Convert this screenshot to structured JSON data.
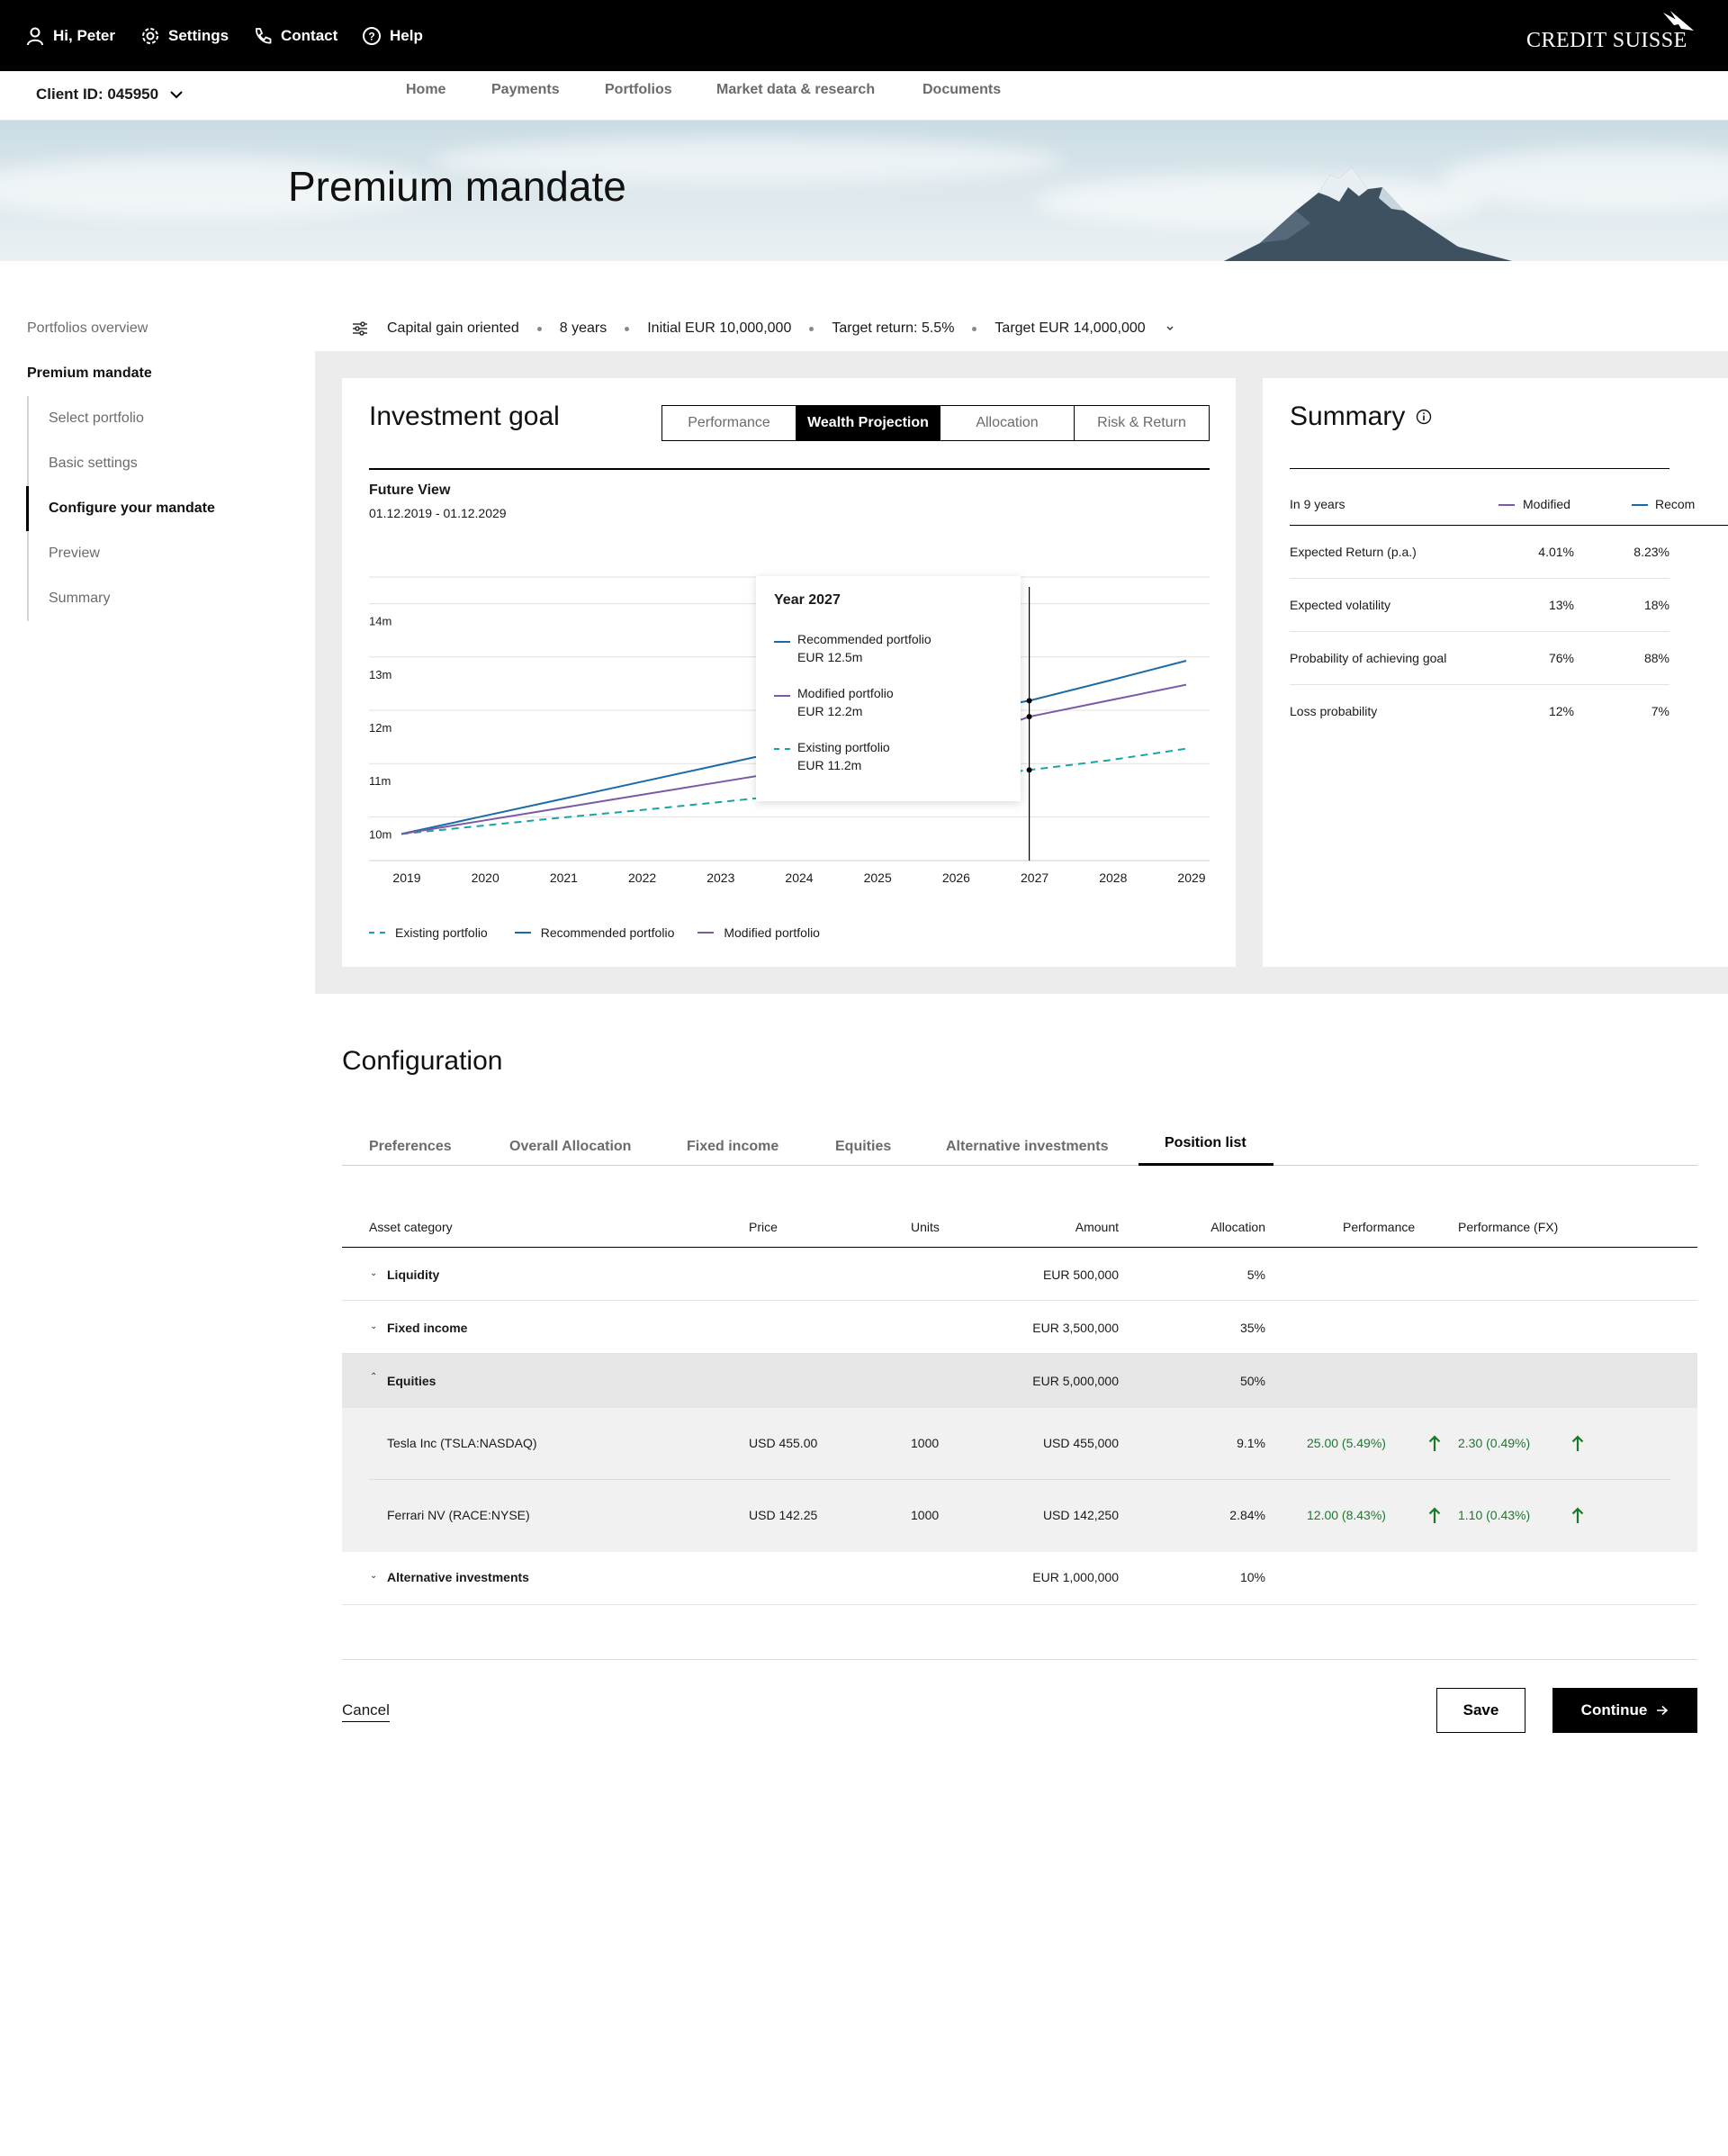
{
  "header": {
    "greeting": "Hi, Peter",
    "settings": "Settings",
    "contact": "Contact",
    "help": "Help",
    "logo": "CREDIT SUISSE"
  },
  "subnav": {
    "client_id": "Client ID: 045950",
    "items": [
      "Home",
      "Payments",
      "Portfolios",
      "Market data & research",
      "Documents"
    ]
  },
  "hero": {
    "title": "Premium mandate"
  },
  "leftnav": {
    "overview": "Portfolios overview",
    "section": "Premium mandate",
    "steps": [
      "Select portfolio",
      "Basic settings",
      "Configure your mandate",
      "Preview",
      "Summary"
    ],
    "active_step": "Configure your mandate"
  },
  "filters": {
    "strategy": "Capital gain oriented",
    "horizon": "8 years",
    "initial": "Initial EUR 10,000,000",
    "target_return": "Target return: 5.5%",
    "target": "Target EUR 14,000,000"
  },
  "investment_goal": {
    "title": "Investment goal",
    "tabs": [
      "Performance",
      "Wealth Projection",
      "Allocation",
      "Risk & Return"
    ],
    "active_tab": "Wealth Projection",
    "subtitle": "Future View",
    "date_range": "01.12.2019 - 01.12.2029"
  },
  "chart_data": {
    "type": "line",
    "x": [
      2019,
      2020,
      2021,
      2022,
      2023,
      2024,
      2025,
      2026,
      2027,
      2028,
      2029
    ],
    "y_ticks": [
      "10m",
      "11m",
      "12m",
      "13m",
      "14m"
    ],
    "ylim": [
      9.5,
      14.5
    ],
    "series": [
      {
        "name": "Existing portfolio",
        "style": "dashed",
        "color": "#19a3a3",
        "values": [
          10.0,
          10.15,
          10.3,
          10.44,
          10.59,
          10.74,
          10.89,
          11.04,
          11.2,
          11.38,
          11.6
        ]
      },
      {
        "name": "Recommended portfolio",
        "style": "solid",
        "color": "#1a6aa8",
        "values": [
          10.0,
          10.32,
          10.64,
          10.96,
          11.28,
          11.6,
          11.92,
          12.24,
          12.5,
          12.87,
          13.25
        ]
      },
      {
        "name": "Modified portfolio",
        "style": "solid",
        "color": "#7a5aa6",
        "values": [
          10.0,
          10.24,
          10.48,
          10.72,
          10.96,
          11.2,
          11.44,
          11.68,
          12.2,
          12.5,
          12.8
        ]
      }
    ],
    "marker_x": 2027,
    "tooltip": {
      "title": "Year 2027",
      "items": [
        {
          "name": "Recommended portfolio",
          "value": "EUR 12.5m"
        },
        {
          "name": "Modified portfolio",
          "value": "EUR 12.2m"
        },
        {
          "name": "Existing portfolio",
          "value": "EUR 11.2m"
        }
      ]
    },
    "legend": [
      "Existing portfolio",
      "Recommended portfolio",
      "Modified portfolio"
    ]
  },
  "summary": {
    "title": "Summary",
    "period": "In 9 years",
    "col_modified": "Modified",
    "col_recommended": "Recom",
    "rows": [
      {
        "label": "Expected Return (p.a.)",
        "modified": "4.01%",
        "recommended": "8.23%"
      },
      {
        "label": "Expected volatility",
        "modified": "13%",
        "recommended": "18%"
      },
      {
        "label": "Probability of achieving goal",
        "modified": "76%",
        "recommended": "88%"
      },
      {
        "label": "Loss probability",
        "modified": "12%",
        "recommended": "7%"
      }
    ]
  },
  "configuration": {
    "title": "Configuration",
    "tabs": [
      "Preferences",
      "Overall Allocation",
      "Fixed income",
      "Equities",
      "Alternative investments",
      "Position list"
    ],
    "active_tab": "Position list",
    "columns": [
      "Asset category",
      "Price",
      "Units",
      "Amount",
      "Allocation",
      "Performance",
      "Performance (FX)"
    ],
    "rows": [
      {
        "name": "Liquidity",
        "amount": "EUR 500,000",
        "allocation": "5%"
      },
      {
        "name": "Fixed income",
        "amount": "EUR 3,500,000",
        "allocation": "35%"
      },
      {
        "name": "Equities",
        "amount": "EUR 5,000,000",
        "allocation": "50%"
      },
      {
        "name": "Alternative investments",
        "amount": "EUR 1,000,000",
        "allocation": "10%"
      }
    ],
    "positions": [
      {
        "name": "Tesla Inc (TSLA:NASDAQ)",
        "price": "USD 455.00",
        "units": "1000",
        "amount": "USD 455,000",
        "allocation": "9.1%",
        "performance": "25.00 (5.49%)",
        "performance_fx": "2.30 (0.49%)"
      },
      {
        "name": "Ferrari NV (RACE:NYSE)",
        "price": "USD 142.25",
        "units": "1000",
        "amount": "USD 142,250",
        "allocation": "2.84%",
        "performance": "12.00 (8.43%)",
        "performance_fx": "1.10 (0.43%)"
      }
    ]
  },
  "actions": {
    "cancel": "Cancel",
    "save": "Save",
    "continue": "Continue"
  }
}
